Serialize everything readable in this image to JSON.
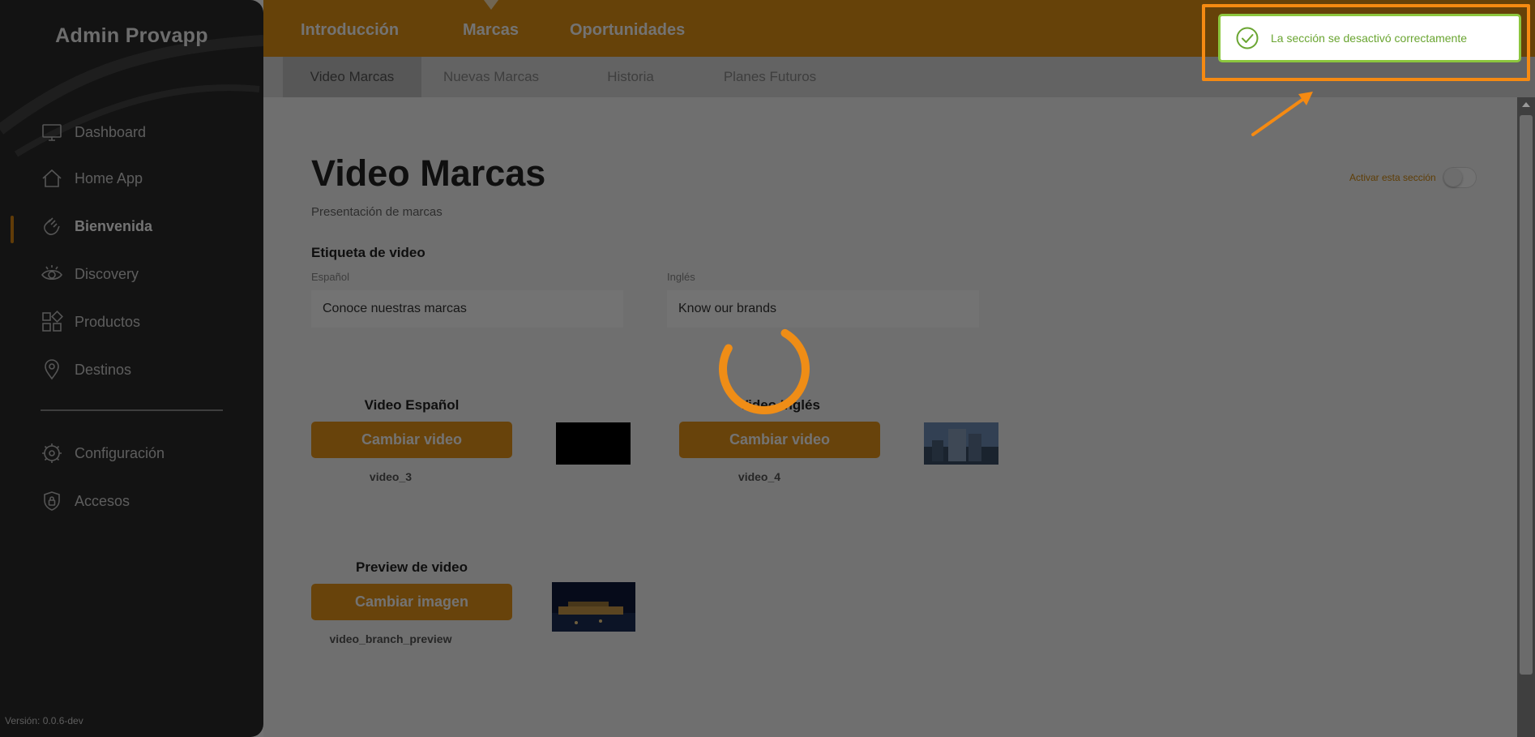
{
  "sidebar": {
    "brand": "Admin Provapp",
    "items": [
      {
        "label": "Dashboard",
        "icon": "monitor-icon"
      },
      {
        "label": "Home App",
        "icon": "home-icon"
      },
      {
        "label": "Bienvenida",
        "icon": "waving-hand-icon",
        "active": true
      },
      {
        "label": "Discovery",
        "icon": "eye-icon"
      },
      {
        "label": "Productos",
        "icon": "grid-icon"
      },
      {
        "label": "Destinos",
        "icon": "location-pin-icon"
      }
    ],
    "bottom_items": [
      {
        "label": "Configuración",
        "icon": "gear-icon"
      },
      {
        "label": "Accesos",
        "icon": "shield-lock-icon"
      }
    ],
    "version": "Versión: 0.0.6-dev"
  },
  "topnav": {
    "tabs": [
      "Introducción",
      "Marcas",
      "Oportunidades"
    ],
    "active_tab": "Marcas"
  },
  "subnav": {
    "tabs": [
      "Video Marcas",
      "Nuevas Marcas",
      "Historia",
      "Planes Futuros"
    ],
    "active_tab": "Video Marcas"
  },
  "page": {
    "title": "Video Marcas",
    "subtitle": "Presentación de marcas",
    "toggle_label": "Activar esta sección",
    "toggle_on": false,
    "video_label": {
      "heading": "Etiqueta de video",
      "spanish_label": "Español",
      "spanish_value": "Conoce nuestras marcas",
      "english_label": "Inglés",
      "english_value": "Know our brands"
    },
    "uploads": {
      "spanish": {
        "title": "Video Español",
        "button": "Cambiar video",
        "file": "video_3"
      },
      "english": {
        "title": "Video Inglés",
        "button": "Cambiar video",
        "file": "video_4"
      },
      "preview": {
        "title": "Preview de video",
        "button": "Cambiar imagen",
        "file": "video_branch_preview"
      }
    }
  },
  "toast": {
    "message": "La sección se desactivó correctamente",
    "icon": "check-circle-icon"
  },
  "colors": {
    "accent": "#e39314",
    "sidebar_bg": "#2a2a2a",
    "success": "#8cc63e",
    "highlight": "#f58a12"
  }
}
